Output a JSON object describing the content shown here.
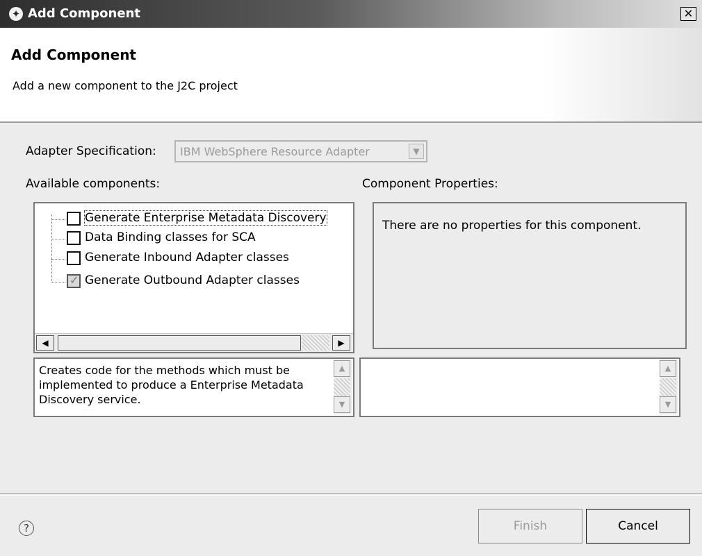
{
  "window": {
    "title": "Add Component",
    "close_label": "✕"
  },
  "banner": {
    "title": "Add Component",
    "description": "Add a new component to the J2C project"
  },
  "adapter": {
    "label": "Adapter Specification:",
    "value": "IBM WebSphere Resource Adapter"
  },
  "components": {
    "label": "Available components:",
    "items": [
      {
        "label": "Generate Enterprise Metadata Discovery",
        "checked": false,
        "selected": true
      },
      {
        "label": "Data Binding classes for SCA",
        "checked": false,
        "selected": false
      },
      {
        "label": "Generate Inbound Adapter classes",
        "checked": false,
        "selected": false
      },
      {
        "label": "Generate Outbound Adapter classes",
        "checked": true,
        "selected": false
      }
    ],
    "description": "Creates code for the methods which must be implemented to produce a Enterprise Metadata Discovery service."
  },
  "properties": {
    "label": "Component Properties:",
    "message": "There are no properties for this component.",
    "description": ""
  },
  "buttons": {
    "finish": "Finish",
    "cancel": "Cancel",
    "finish_enabled": false
  },
  "icons": {
    "help": "help-icon",
    "app": "wizard-app-icon"
  }
}
